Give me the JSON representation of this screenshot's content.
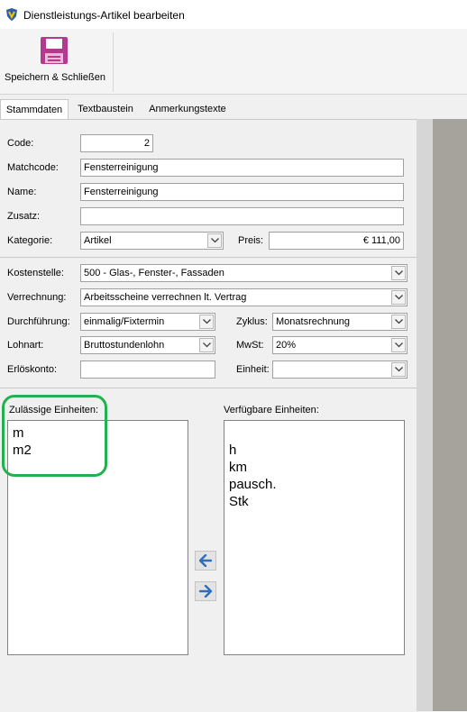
{
  "window": {
    "title": "Dienstleistungs-Artikel bearbeiten"
  },
  "toolbar": {
    "save_label": "Speichern & Schließen",
    "save_icon": "floppy-disk-icon",
    "save_icon_color": "#b33a8e"
  },
  "tabs": [
    {
      "label": "Stammdaten",
      "active": true
    },
    {
      "label": "Textbaustein",
      "active": false
    },
    {
      "label": "Anmerkungstexte",
      "active": false
    }
  ],
  "form": {
    "code": {
      "label": "Code:",
      "value": "2"
    },
    "matchcode": {
      "label": "Matchcode:",
      "value": "Fensterreinigung"
    },
    "name": {
      "label": "Name:",
      "value": "Fensterreinigung"
    },
    "zusatz": {
      "label": "Zusatz:",
      "value": ""
    },
    "kategorie": {
      "label": "Kategorie:",
      "value": "Artikel"
    },
    "preis": {
      "label": "Preis:",
      "value": "€ 111,00"
    },
    "kostenstelle": {
      "label": "Kostenstelle:",
      "value": "500 - Glas-, Fenster-, Fassaden"
    },
    "verrechnung": {
      "label": "Verrechnung:",
      "value": "Arbeitsscheine verrechnen lt. Vertrag"
    },
    "durchfuehrung": {
      "label": "Durchführung:",
      "value": "einmalig/Fixtermin"
    },
    "zyklus": {
      "label": "Zyklus:",
      "value": "Monatsrechnung"
    },
    "lohnart": {
      "label": "Lohnart:",
      "value": "Bruttostundenlohn"
    },
    "mwst": {
      "label": "MwSt:",
      "value": "20%"
    },
    "erloeskonto": {
      "label": "Erlöskonto:",
      "value": ""
    },
    "einheit": {
      "label": "Einheit:",
      "value": ""
    }
  },
  "units": {
    "allowed_label": "Zulässige Einheiten:",
    "allowed": [
      "m",
      "m2"
    ],
    "available_label": "Verfügbare Einheiten:",
    "available": [
      "",
      "h",
      "km",
      "pausch.",
      "Stk"
    ]
  },
  "colors": {
    "highlight": "#22b14c",
    "arrow": "#2f6fb8"
  }
}
